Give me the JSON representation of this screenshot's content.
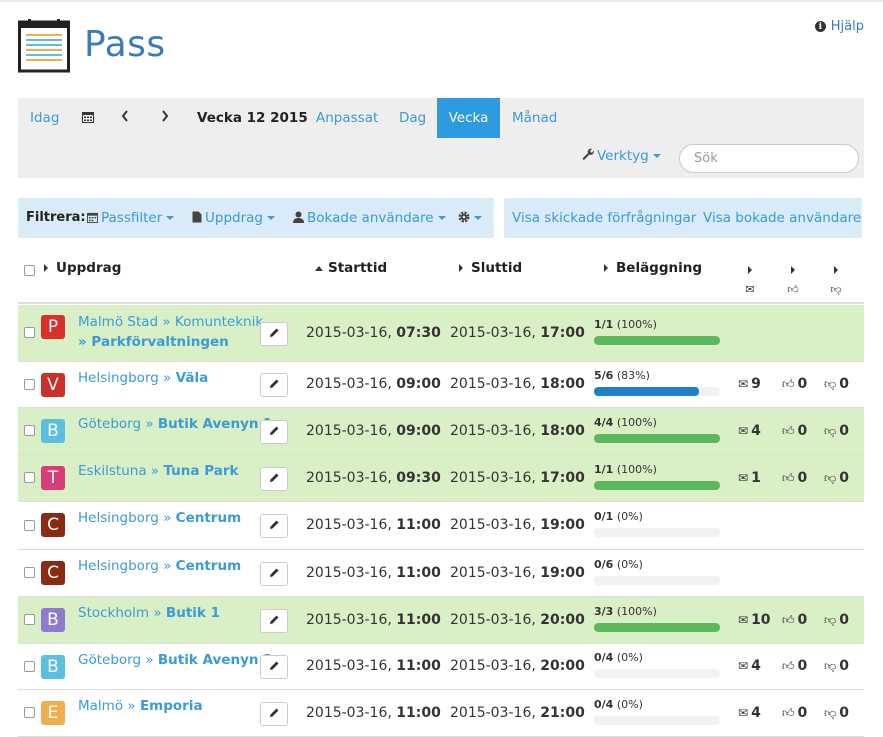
{
  "header": {
    "title": "Pass",
    "help_label": "Hjälp"
  },
  "calendar": {
    "today": "Idag",
    "week_label": "Vecka 12 2015",
    "custom": "Anpassat",
    "day": "Dag",
    "week": "Vecka",
    "month": "Månad",
    "active_view": "Vecka",
    "tools": "Verktyg",
    "search_placeholder": "Sök"
  },
  "filters": {
    "label": "Filtrera:",
    "passfilter": "Passfilter",
    "uppdrag": "Uppdrag",
    "booked_users": "Bokade användare",
    "show_requests": "Visa skickade förfrågningar",
    "show_booked": "Visa bokade användare"
  },
  "table": {
    "headers": {
      "assignment": "Uppdrag",
      "start": "Starttid",
      "end": "Sluttid",
      "occupancy": "Beläggning"
    },
    "header_icons": [
      "envelope-icon",
      "thumbs-up-icon",
      "thumbs-down-icon"
    ],
    "rows": [
      {
        "letter": "P",
        "color": "#d9302c",
        "green": true,
        "loc": "Malmö Stad » Komunteknik",
        "sub": "» Parkförvaltningen",
        "start_date": "2015-03-16, ",
        "start_time": "07:30",
        "end_date": "2015-03-16, ",
        "end_time": "17:00",
        "occ_count": "1/1",
        "occ_pct": "(100%)",
        "fill": 1.0,
        "fill_color": "#5cb85c",
        "mail": "",
        "up": "",
        "down": ""
      },
      {
        "letter": "V",
        "color": "#c9302c",
        "green": false,
        "loc": "Helsingborg » ",
        "sub": "Väla",
        "start_date": "2015-03-16, ",
        "start_time": "09:00",
        "end_date": "2015-03-16, ",
        "end_time": "18:00",
        "occ_count": "5/6",
        "occ_pct": "(83%)",
        "fill": 0.83,
        "fill_color": "#1f7fc9",
        "mail": "9",
        "up": "0",
        "down": "0"
      },
      {
        "letter": "B",
        "color": "#5bc0de",
        "green": true,
        "loc": "Göteborg » ",
        "sub": "Butik Avenyn 1",
        "start_date": "2015-03-16, ",
        "start_time": "09:00",
        "end_date": "2015-03-16, ",
        "end_time": "18:00",
        "occ_count": "4/4",
        "occ_pct": "(100%)",
        "fill": 1.0,
        "fill_color": "#5cb85c",
        "mail": "4",
        "up": "0",
        "down": "0"
      },
      {
        "letter": "T",
        "color": "#d83d7a",
        "green": true,
        "loc": "Eskilstuna » ",
        "sub": "Tuna Park",
        "start_date": "2015-03-16, ",
        "start_time": "09:30",
        "end_date": "2015-03-16, ",
        "end_time": "17:00",
        "occ_count": "1/1",
        "occ_pct": "(100%)",
        "fill": 1.0,
        "fill_color": "#5cb85c",
        "mail": "1",
        "up": "0",
        "down": "0"
      },
      {
        "letter": "C",
        "color": "#8b2a12",
        "green": false,
        "loc": "Helsingborg » ",
        "sub": "Centrum",
        "start_date": "2015-03-16, ",
        "start_time": "11:00",
        "end_date": "2015-03-16, ",
        "end_time": "19:00",
        "occ_count": "0/1",
        "occ_pct": "(0%)",
        "fill": 0,
        "fill_color": "#5cb85c",
        "mail": "",
        "up": "",
        "down": ""
      },
      {
        "letter": "C",
        "color": "#8b2a12",
        "green": false,
        "loc": "Helsingborg » ",
        "sub": "Centrum",
        "start_date": "2015-03-16, ",
        "start_time": "11:00",
        "end_date": "2015-03-16, ",
        "end_time": "19:00",
        "occ_count": "0/6",
        "occ_pct": "(0%)",
        "fill": 0,
        "fill_color": "#5cb85c",
        "mail": "",
        "up": "",
        "down": ""
      },
      {
        "letter": "B",
        "color": "#8e7bd0",
        "green": true,
        "loc": "Stockholm » ",
        "sub": "Butik 1",
        "start_date": "2015-03-16, ",
        "start_time": "11:00",
        "end_date": "2015-03-16, ",
        "end_time": "20:00",
        "occ_count": "3/3",
        "occ_pct": "(100%)",
        "fill": 1.0,
        "fill_color": "#5cb85c",
        "mail": "10",
        "up": "0",
        "down": "0"
      },
      {
        "letter": "B",
        "color": "#5bc0de",
        "green": false,
        "loc": "Göteborg » ",
        "sub": "Butik Avenyn 2",
        "start_date": "2015-03-16, ",
        "start_time": "11:00",
        "end_date": "2015-03-16, ",
        "end_time": "20:00",
        "occ_count": "0/4",
        "occ_pct": "(0%)",
        "fill": 0,
        "fill_color": "#5cb85c",
        "mail": "4",
        "up": "0",
        "down": "0"
      },
      {
        "letter": "E",
        "color": "#f0ad4e",
        "green": false,
        "loc": "Malmö » ",
        "sub": "Emporia",
        "start_date": "2015-03-16, ",
        "start_time": "11:00",
        "end_date": "2015-03-16, ",
        "end_time": "21:00",
        "occ_count": "0/4",
        "occ_pct": "(0%)",
        "fill": 0,
        "fill_color": "#5cb85c",
        "mail": "4",
        "up": "0",
        "down": "0"
      }
    ]
  }
}
